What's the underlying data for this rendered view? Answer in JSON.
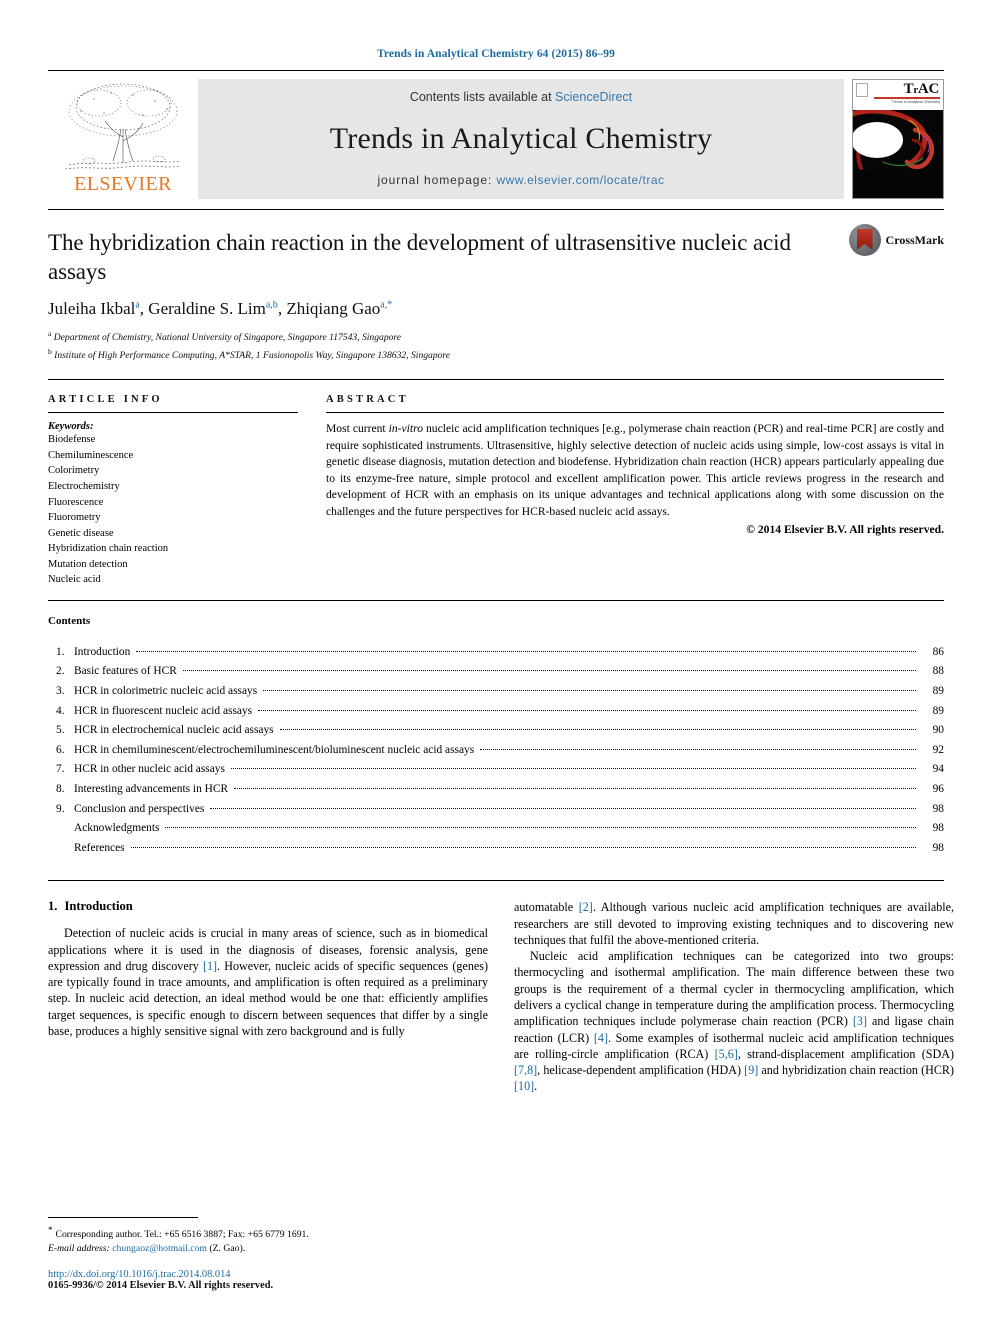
{
  "running_head": "Trends in Analytical Chemistry 64 (2015) 86–99",
  "masthead": {
    "publisher_name": "ELSEVIER",
    "contents_prefix": "Contents lists available at",
    "contents_link": "ScienceDirect",
    "journal_title": "Trends in Analytical Chemistry",
    "homepage_label": "journal homepage:",
    "homepage_url": "www.elsevier.com/locate/trac",
    "cover_title": "TrAC",
    "cover_subtitle": "Trends in Analytical Chemistry"
  },
  "article": {
    "title": "The hybridization chain reaction in the development of ultrasensitive nucleic acid assays",
    "authors": [
      {
        "name": "Juleiha Ikbal",
        "marks": "a"
      },
      {
        "name": "Geraldine S. Lim",
        "marks": "a,b"
      },
      {
        "name": "Zhiqiang Gao",
        "marks": "a,*"
      }
    ],
    "affiliations": [
      {
        "mark": "a",
        "text": "Department of Chemistry, National University of Singapore, Singapore 117543, Singapore"
      },
      {
        "mark": "b",
        "text": "Institute of High Performance Computing, A*STAR, 1 Fusionopolis Way, Singapore 138632, Singapore"
      }
    ],
    "crossmark_label": "CrossMark"
  },
  "article_info": {
    "heading": "ARTICLE INFO",
    "keywords_label": "Keywords:",
    "keywords": [
      "Biodefense",
      "Chemiluminescence",
      "Colorimetry",
      "Electrochemistry",
      "Fluorescence",
      "Fluorometry",
      "Genetic disease",
      "Hybridization chain reaction",
      "Mutation detection",
      "Nucleic acid"
    ]
  },
  "abstract": {
    "heading": "ABSTRACT",
    "text_parts": [
      {
        "t": "Most current "
      },
      {
        "t": "in-vitro",
        "i": true
      },
      {
        "t": " nucleic acid amplification techniques [e.g., polymerase chain reaction (PCR) and real-time PCR] are costly and require sophisticated instruments. Ultrasensitive, highly selective detection of nucleic acids using simple, low-cost assays is vital in genetic disease diagnosis, mutation detection and biodefense. Hybridization chain reaction (HCR) appears particularly appealing due to its enzyme-free nature, simple protocol and excellent amplification power. This article reviews progress in the research and development of HCR with an emphasis on its unique advantages and technical applications along with some discussion on the challenges and the future perspectives for HCR-based nucleic acid assays."
      }
    ],
    "copyright": "© 2014 Elsevier B.V. All rights reserved."
  },
  "contents": {
    "heading": "Contents",
    "items": [
      {
        "num": "1.",
        "label": "Introduction",
        "page": "86"
      },
      {
        "num": "2.",
        "label": "Basic features of HCR",
        "page": "88"
      },
      {
        "num": "3.",
        "label": "HCR in colorimetric nucleic acid assays",
        "page": "89"
      },
      {
        "num": "4.",
        "label": "HCR in fluorescent nucleic acid assays",
        "page": "89"
      },
      {
        "num": "5.",
        "label": "HCR in electrochemical nucleic acid assays",
        "page": "90"
      },
      {
        "num": "6.",
        "label": "HCR in chemiluminescent/electrochemiluminescent/bioluminescent nucleic acid assays",
        "page": "92"
      },
      {
        "num": "7.",
        "label": "HCR in other nucleic acid assays",
        "page": "94"
      },
      {
        "num": "8.",
        "label": "Interesting advancements in HCR",
        "page": "96"
      },
      {
        "num": "9.",
        "label": "Conclusion and perspectives",
        "page": "98"
      },
      {
        "num": "",
        "label": "Acknowledgments",
        "page": "98"
      },
      {
        "num": "",
        "label": "References",
        "page": "98"
      }
    ]
  },
  "body": {
    "section_number": "1.",
    "section_title": "Introduction",
    "left_paragraph": "Detection of nucleic acids is crucial in many areas of science, such as in biomedical applications where it is used in the diagnosis of diseases, forensic analysis, gene expression and drug discovery [1]. However, nucleic acids of specific sequences (genes) are typically found in trace amounts, and amplification is often required as a preliminary step. In nucleic acid detection, an ideal method would be one that: efficiently amplifies target sequences, is specific enough to discern between sequences that differ by a single base, produces a highly sensitive signal with zero background and is fully",
    "right_paragraph_1": "automatable [2]. Although various nucleic acid amplification techniques are available, researchers are still devoted to improving existing techniques and to discovering new techniques that fulfil the above-mentioned criteria.",
    "right_paragraph_2": "Nucleic acid amplification techniques can be categorized into two groups: thermocycling and isothermal amplification. The main difference between these two groups is the requirement of a thermal cycler in thermocycling amplification, which delivers a cyclical change in temperature during the amplification process. Thermocycling amplification techniques include polymerase chain reaction (PCR) [3] and ligase chain reaction (LCR) [4]. Some examples of isothermal nucleic acid amplification techniques are rolling-circle amplification (RCA) [5,6], strand-displacement amplification (SDA) [7,8], helicase-dependent amplification (HDA) [9] and hybridization chain reaction (HCR) [10]."
  },
  "footnotes": {
    "corresponding": "Corresponding author. Tel.: +65 6516 3887; Fax: +65 6779 1691.",
    "email_label": "E-mail address:",
    "email": "chungaoz@hotmail.com",
    "email_owner": "(Z. Gao).",
    "doi": "http://dx.doi.org/10.1016/j.trac.2014.08.014",
    "issn_line": "0165-9936/© 2014 Elsevier B.V. All rights reserved."
  },
  "colors": {
    "link_blue": "#1a6ba0",
    "elsevier_orange": "#E87722",
    "band_grey": "#e6e6e6",
    "crossmark_red": "#c0392b"
  }
}
